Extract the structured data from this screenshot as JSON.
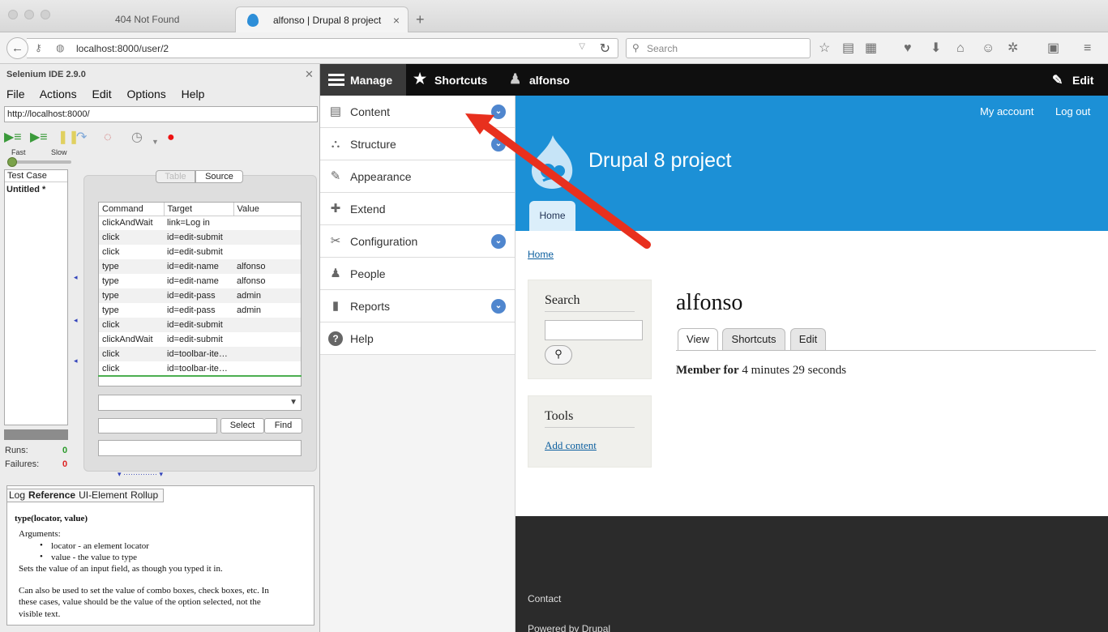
{
  "browser": {
    "tabs": [
      {
        "label": "404 Not Found"
      },
      {
        "label": "alfonso | Drupal 8 project"
      }
    ],
    "url": "localhost:8000/user/2",
    "search_placeholder": "Search"
  },
  "selenium": {
    "title": "Selenium IDE 2.9.0",
    "menu": [
      "File",
      "Actions",
      "Edit",
      "Options",
      "Help"
    ],
    "base_url": "http://localhost:8000/",
    "speed": {
      "fast": "Fast",
      "slow": "Slow"
    },
    "test_case_header": "Test Case",
    "test_case_item": "Untitled *",
    "runs_label": "Runs:",
    "runs": "0",
    "failures_label": "Failures:",
    "failures": "0",
    "view_tabs": {
      "table": "Table",
      "source": "Source"
    },
    "columns": [
      "Command",
      "Target",
      "Value"
    ],
    "commands": [
      [
        "clickAndWait",
        "link=Log in",
        ""
      ],
      [
        "click",
        "id=edit-submit",
        ""
      ],
      [
        "click",
        "id=edit-submit",
        ""
      ],
      [
        "type",
        "id=edit-name",
        "alfonso"
      ],
      [
        "type",
        "id=edit-name",
        "alfonso"
      ],
      [
        "type",
        "id=edit-pass",
        "admin"
      ],
      [
        "type",
        "id=edit-pass",
        "admin"
      ],
      [
        "click",
        "id=edit-submit",
        ""
      ],
      [
        "clickAndWait",
        "id=edit-submit",
        ""
      ],
      [
        "click",
        "id=toolbar-ite…",
        ""
      ],
      [
        "click",
        "id=toolbar-ite…",
        ""
      ]
    ],
    "select_btn": "Select",
    "find_btn": "Find",
    "ref_tabs": [
      "Log",
      "Reference",
      "UI-Element",
      "Rollup"
    ],
    "ref": {
      "signature": "type(locator, value)",
      "arguments": "Arguments:",
      "arg1": "locator - an element locator",
      "arg2": "value - the value to type",
      "desc1": "Sets the value of an input field, as though you typed it in.",
      "desc2": "Can also be used to set the value of combo boxes, check boxes, etc. In",
      "desc3": "these cases, value should be the value of the option selected, not the",
      "desc4": "visible text."
    }
  },
  "drupal": {
    "toolbar": {
      "manage": "Manage",
      "shortcuts": "Shortcuts",
      "user": "alfonso",
      "edit": "Edit"
    },
    "tray": [
      {
        "label": "Content",
        "icon": "page-icon",
        "chevron": true
      },
      {
        "label": "Structure",
        "icon": "sitemap-icon",
        "chevron": true
      },
      {
        "label": "Appearance",
        "icon": "brush-icon",
        "chevron": false
      },
      {
        "label": "Extend",
        "icon": "puzzle-icon",
        "chevron": false
      },
      {
        "label": "Configuration",
        "icon": "wrench-icon",
        "chevron": true
      },
      {
        "label": "People",
        "icon": "people-icon",
        "chevron": false
      },
      {
        "label": "Reports",
        "icon": "bar-chart-icon",
        "chevron": true
      },
      {
        "label": "Help",
        "icon": "help-icon",
        "chevron": false
      }
    ],
    "site_name": "Drupal 8 project",
    "my_account": "My account",
    "log_out": "Log out",
    "home_tab": "Home",
    "breadcrumb": "Home",
    "search_title": "Search",
    "tools_title": "Tools",
    "add_content": "Add content",
    "page_title": "alfonso",
    "tabs": [
      "View",
      "Shortcuts",
      "Edit"
    ],
    "member_label": "Member for",
    "member_value": "4 minutes 29 seconds",
    "footer_contact": "Contact",
    "footer_powered": "Powered by Drupal",
    "colors": {
      "hero": "#1c90d6",
      "toolbar": "#0f0f0f",
      "annotation": "#e8301e"
    }
  }
}
